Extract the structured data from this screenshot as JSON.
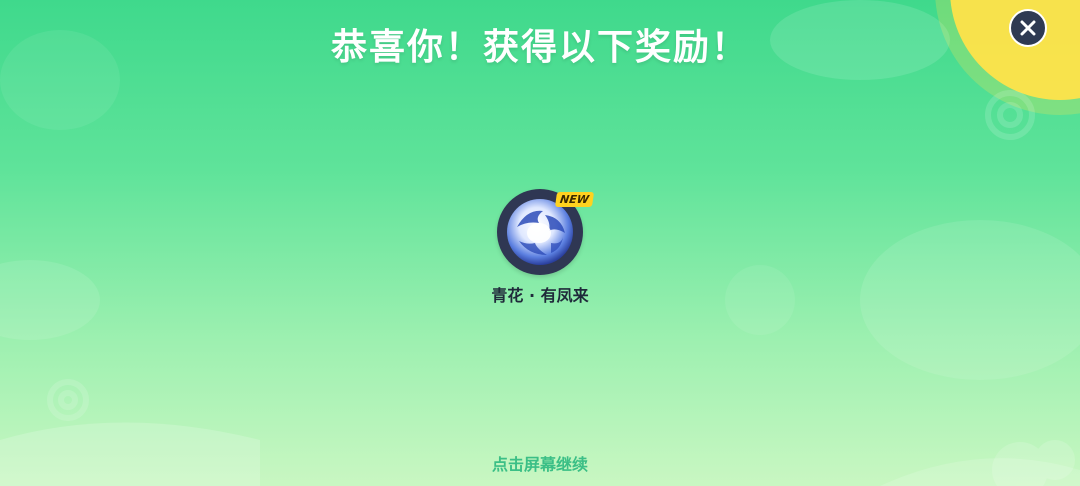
{
  "header": {
    "title": "恭喜你！获得以下奖励！"
  },
  "close_button": {
    "icon": "close-icon"
  },
  "rewards": [
    {
      "name": "青花 · 有凤来",
      "badge": "NEW",
      "icon": "blue-white-porcelain-orb-icon"
    }
  ],
  "footer": {
    "hint": "点击屏幕继续"
  },
  "colors": {
    "background_top": "#3fd98c",
    "background_bottom": "#c9f7c2",
    "title_text": "#ffffff",
    "close_button_bg": "#2f3a52",
    "badge_bg": "#ffd21f",
    "hint_text": "#3bbf86",
    "sun_corner": "#ffe34a"
  }
}
